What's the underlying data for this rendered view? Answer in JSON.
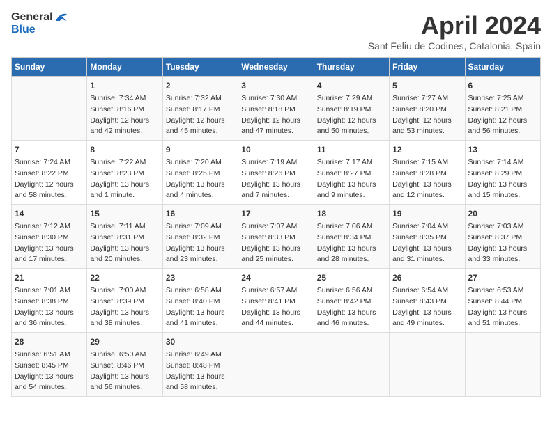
{
  "header": {
    "logo_general": "General",
    "logo_blue": "Blue",
    "title": "April 2024",
    "subtitle": "Sant Feliu de Codines, Catalonia, Spain"
  },
  "columns": [
    "Sunday",
    "Monday",
    "Tuesday",
    "Wednesday",
    "Thursday",
    "Friday",
    "Saturday"
  ],
  "weeks": [
    [
      {
        "day": "",
        "content": ""
      },
      {
        "day": "1",
        "content": "Sunrise: 7:34 AM\nSunset: 8:16 PM\nDaylight: 12 hours\nand 42 minutes."
      },
      {
        "day": "2",
        "content": "Sunrise: 7:32 AM\nSunset: 8:17 PM\nDaylight: 12 hours\nand 45 minutes."
      },
      {
        "day": "3",
        "content": "Sunrise: 7:30 AM\nSunset: 8:18 PM\nDaylight: 12 hours\nand 47 minutes."
      },
      {
        "day": "4",
        "content": "Sunrise: 7:29 AM\nSunset: 8:19 PM\nDaylight: 12 hours\nand 50 minutes."
      },
      {
        "day": "5",
        "content": "Sunrise: 7:27 AM\nSunset: 8:20 PM\nDaylight: 12 hours\nand 53 minutes."
      },
      {
        "day": "6",
        "content": "Sunrise: 7:25 AM\nSunset: 8:21 PM\nDaylight: 12 hours\nand 56 minutes."
      }
    ],
    [
      {
        "day": "7",
        "content": "Sunrise: 7:24 AM\nSunset: 8:22 PM\nDaylight: 12 hours\nand 58 minutes."
      },
      {
        "day": "8",
        "content": "Sunrise: 7:22 AM\nSunset: 8:23 PM\nDaylight: 13 hours\nand 1 minute."
      },
      {
        "day": "9",
        "content": "Sunrise: 7:20 AM\nSunset: 8:25 PM\nDaylight: 13 hours\nand 4 minutes."
      },
      {
        "day": "10",
        "content": "Sunrise: 7:19 AM\nSunset: 8:26 PM\nDaylight: 13 hours\nand 7 minutes."
      },
      {
        "day": "11",
        "content": "Sunrise: 7:17 AM\nSunset: 8:27 PM\nDaylight: 13 hours\nand 9 minutes."
      },
      {
        "day": "12",
        "content": "Sunrise: 7:15 AM\nSunset: 8:28 PM\nDaylight: 13 hours\nand 12 minutes."
      },
      {
        "day": "13",
        "content": "Sunrise: 7:14 AM\nSunset: 8:29 PM\nDaylight: 13 hours\nand 15 minutes."
      }
    ],
    [
      {
        "day": "14",
        "content": "Sunrise: 7:12 AM\nSunset: 8:30 PM\nDaylight: 13 hours\nand 17 minutes."
      },
      {
        "day": "15",
        "content": "Sunrise: 7:11 AM\nSunset: 8:31 PM\nDaylight: 13 hours\nand 20 minutes."
      },
      {
        "day": "16",
        "content": "Sunrise: 7:09 AM\nSunset: 8:32 PM\nDaylight: 13 hours\nand 23 minutes."
      },
      {
        "day": "17",
        "content": "Sunrise: 7:07 AM\nSunset: 8:33 PM\nDaylight: 13 hours\nand 25 minutes."
      },
      {
        "day": "18",
        "content": "Sunrise: 7:06 AM\nSunset: 8:34 PM\nDaylight: 13 hours\nand 28 minutes."
      },
      {
        "day": "19",
        "content": "Sunrise: 7:04 AM\nSunset: 8:35 PM\nDaylight: 13 hours\nand 31 minutes."
      },
      {
        "day": "20",
        "content": "Sunrise: 7:03 AM\nSunset: 8:37 PM\nDaylight: 13 hours\nand 33 minutes."
      }
    ],
    [
      {
        "day": "21",
        "content": "Sunrise: 7:01 AM\nSunset: 8:38 PM\nDaylight: 13 hours\nand 36 minutes."
      },
      {
        "day": "22",
        "content": "Sunrise: 7:00 AM\nSunset: 8:39 PM\nDaylight: 13 hours\nand 38 minutes."
      },
      {
        "day": "23",
        "content": "Sunrise: 6:58 AM\nSunset: 8:40 PM\nDaylight: 13 hours\nand 41 minutes."
      },
      {
        "day": "24",
        "content": "Sunrise: 6:57 AM\nSunset: 8:41 PM\nDaylight: 13 hours\nand 44 minutes."
      },
      {
        "day": "25",
        "content": "Sunrise: 6:56 AM\nSunset: 8:42 PM\nDaylight: 13 hours\nand 46 minutes."
      },
      {
        "day": "26",
        "content": "Sunrise: 6:54 AM\nSunset: 8:43 PM\nDaylight: 13 hours\nand 49 minutes."
      },
      {
        "day": "27",
        "content": "Sunrise: 6:53 AM\nSunset: 8:44 PM\nDaylight: 13 hours\nand 51 minutes."
      }
    ],
    [
      {
        "day": "28",
        "content": "Sunrise: 6:51 AM\nSunset: 8:45 PM\nDaylight: 13 hours\nand 54 minutes."
      },
      {
        "day": "29",
        "content": "Sunrise: 6:50 AM\nSunset: 8:46 PM\nDaylight: 13 hours\nand 56 minutes."
      },
      {
        "day": "30",
        "content": "Sunrise: 6:49 AM\nSunset: 8:48 PM\nDaylight: 13 hours\nand 58 minutes."
      },
      {
        "day": "",
        "content": ""
      },
      {
        "day": "",
        "content": ""
      },
      {
        "day": "",
        "content": ""
      },
      {
        "day": "",
        "content": ""
      }
    ]
  ]
}
